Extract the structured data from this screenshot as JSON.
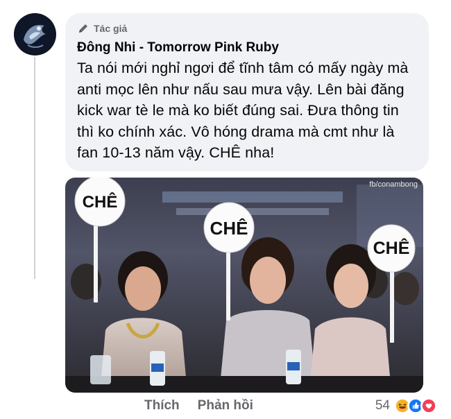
{
  "comment": {
    "badge_label": "Tác giả",
    "author_name": "Đông Nhi - Tomorrow Pink Ruby",
    "text": "Ta nói mới nghỉ ngơi để tĩnh tâm có mấy ngày mà anti mọc lên như nấu sau mưa vậy. Lên bài đăng kick war tè le mà ko biết đúng sai. Đưa thông tin thì ko chính xác. Vô hóng drama mà cmt như là fan 10-13 năm vậy. CHÊ nha!"
  },
  "photo": {
    "signs": [
      "CHÊ",
      "CHÊ",
      "CHÊ"
    ],
    "watermark": "fb/conambong"
  },
  "actions": {
    "like_label": "Thích",
    "reply_label": "Phản hồi"
  },
  "reactions": {
    "count": "54",
    "icons": [
      "haha-icon",
      "like-icon",
      "love-icon"
    ]
  },
  "colors": {
    "bubble_bg": "#f0f2f5",
    "secondary_text": "#65676b",
    "like_blue": "#1877f2",
    "love_red": "#f33e58",
    "haha_yellow": "#f7b125"
  }
}
